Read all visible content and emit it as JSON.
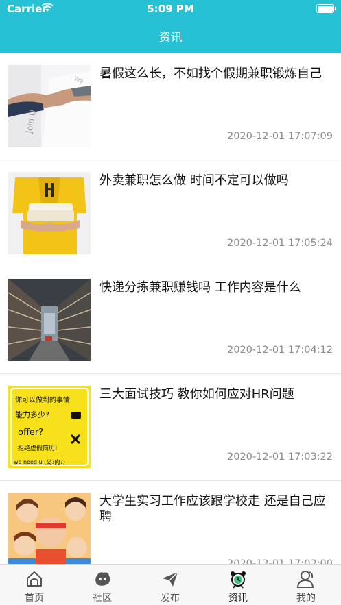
{
  "status_bar": {
    "carrier": "Carrier",
    "time": "5:09 PM"
  },
  "nav": {
    "title": "资讯"
  },
  "articles": [
    {
      "title": "暑假这么长，不如找个假期兼职锻炼自己",
      "date": "2020-12-01 17:07:09",
      "thumb": "handshake-photo"
    },
    {
      "title": "外卖兼职怎么做 时间不定可以做吗",
      "date": "2020-12-01 17:05:24",
      "thumb": "delivery-photo"
    },
    {
      "title": "快递分拣兼职赚钱吗 工作内容是什么",
      "date": "2020-12-01 17:04:12",
      "thumb": "warehouse-photo"
    },
    {
      "title": "三大面试技巧 教你如何应对HR问题",
      "date": "2020-12-01 17:03:22",
      "thumb": "interview-illustration",
      "thumb_text": [
        "你可以做到的事情",
        "能力多少?",
        "offer?",
        "拒绝虚假简历!",
        "we need u (又?肉?)"
      ]
    },
    {
      "title": " 大学生实习工作应该跟学校走 还是自己应聘",
      "date": "2020-12-01 17:02:00",
      "thumb": "students-illustration"
    }
  ],
  "tabbar": {
    "tabs": [
      {
        "label": "首页",
        "icon": "home-icon"
      },
      {
        "label": "社区",
        "icon": "community-icon"
      },
      {
        "label": "发布",
        "icon": "send-icon"
      },
      {
        "label": "资讯",
        "icon": "alarm-clock-icon",
        "active": true
      },
      {
        "label": "我的",
        "icon": "user-icon"
      }
    ]
  },
  "colors": {
    "primary": "#27c1d6",
    "text": "#111111",
    "date": "#8c8c8c",
    "tab_label": "#555555",
    "divider": "#e6e6e6"
  }
}
